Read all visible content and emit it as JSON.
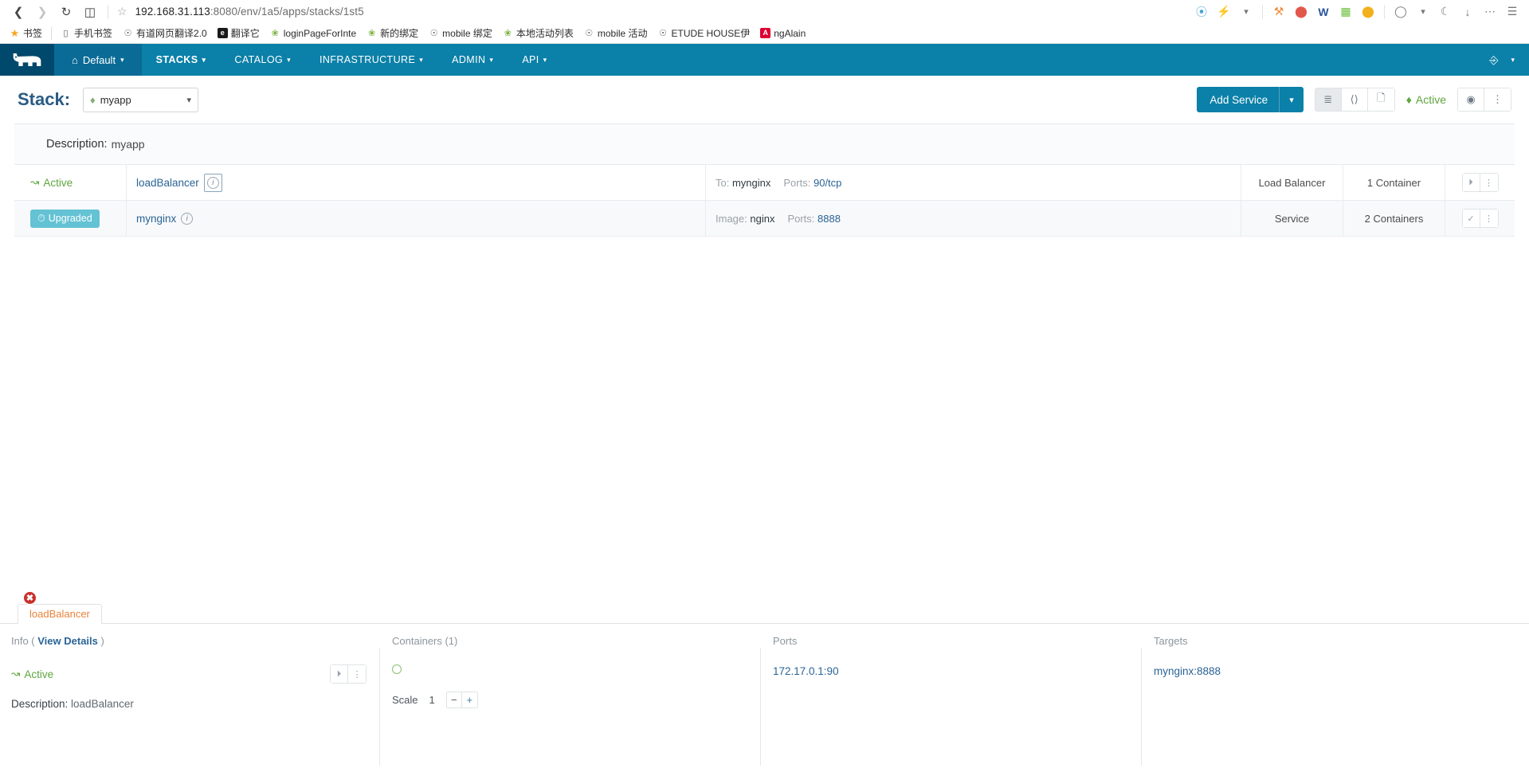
{
  "browser": {
    "back_icon": "back-arrow-icon",
    "forward_icon": "forward-arrow-icon",
    "reload_icon": "reload-icon",
    "reader_icon": "reader-view-icon",
    "star_icon": "star-icon",
    "url_prefix": "192.168.31.113",
    "url_suffix": ":8080/env/1a5/apps/stacks/1st5",
    "url_full": "192.168.31.113:8080/env/1a5/apps/stacks/1st5",
    "toolbar_icons": [
      {
        "name": "sync-icon",
        "glyph": "◔"
      },
      {
        "name": "flash-icon",
        "glyph": "⚡"
      },
      {
        "name": "chevron-down-icon",
        "glyph": "⌄"
      },
      {
        "name": "game-controller-icon",
        "glyph": "⚈"
      },
      {
        "name": "shield-icon",
        "glyph": "●"
      },
      {
        "name": "word-icon",
        "glyph": "W"
      },
      {
        "name": "grid-icon",
        "glyph": "⌗"
      },
      {
        "name": "circle-icon",
        "glyph": "◯"
      },
      {
        "name": "user-icon",
        "glyph": "○"
      },
      {
        "name": "moon-icon",
        "glyph": "☾"
      },
      {
        "name": "download-icon",
        "glyph": "⬇"
      },
      {
        "name": "more-icon",
        "glyph": "⋯"
      },
      {
        "name": "window-icon",
        "glyph": "⬜"
      }
    ],
    "bookmarks": [
      {
        "label": "书签",
        "icon": "star-icon",
        "type": "star"
      },
      {
        "label": "手机书签",
        "icon": "phone-icon",
        "type": "phone"
      },
      {
        "label": "有道网页翻译2.0",
        "icon": "globe-icon",
        "type": "globe"
      },
      {
        "label": "翻译它",
        "icon": "translate-icon",
        "type": "sqe"
      },
      {
        "label": "loginPageForInte",
        "icon": "leaf-icon",
        "type": "leaf"
      },
      {
        "label": "新的绑定",
        "icon": "leaf-icon",
        "type": "leaf"
      },
      {
        "label": "mobile 绑定",
        "icon": "globe-icon",
        "type": "globe"
      },
      {
        "label": "本地活动列表",
        "icon": "leaf-icon",
        "type": "leaf"
      },
      {
        "label": "mobile 活动",
        "icon": "globe-icon",
        "type": "globe"
      },
      {
        "label": "ETUDE HOUSE伊",
        "icon": "globe-icon",
        "type": "globe"
      },
      {
        "label": "ngAlain",
        "icon": "angular-icon",
        "type": "nga"
      }
    ]
  },
  "nav": {
    "logo": "rancher-cow-logo",
    "environment": "Default",
    "items": [
      {
        "label": "STACKS",
        "active": true
      },
      {
        "label": "CATALOG",
        "active": false
      },
      {
        "label": "INFRASTRUCTURE",
        "active": false
      },
      {
        "label": "ADMIN",
        "active": false
      },
      {
        "label": "API",
        "active": false
      }
    ],
    "user_icon": "user-icon",
    "user_caret": "⌄"
  },
  "stack_header": {
    "title": "Stack:",
    "selected_stack": "myapp",
    "add_service_label": "Add Service",
    "view_icons": [
      {
        "name": "list-view-icon",
        "glyph": "☰",
        "selected": true
      },
      {
        "name": "graph-view-icon",
        "glyph": "⚭",
        "selected": false
      },
      {
        "name": "config-view-icon",
        "glyph": "὜b",
        "selected": false
      }
    ],
    "state_label": "Active",
    "state_icon": "stack-icon",
    "action_icons": [
      {
        "name": "pause-icon",
        "glyph": "●"
      },
      {
        "name": "kebab-menu-icon",
        "glyph": "⋮"
      }
    ]
  },
  "description": {
    "key": "Description:",
    "value": "myapp"
  },
  "services": {
    "rows": [
      {
        "state": "Active",
        "state_type": "active",
        "name": "loadBalancer",
        "info_focused": true,
        "meta": [
          {
            "key": "To:",
            "value": "mynginx",
            "link": false
          },
          {
            "key": "Ports:",
            "value": "90/tcp",
            "link": true
          }
        ],
        "type": "Load Balancer",
        "containers": "1 Container",
        "actions": [
          {
            "name": "upgrade-icon",
            "glyph": "↑"
          },
          {
            "name": "kebab-menu-icon",
            "glyph": "⋮"
          }
        ]
      },
      {
        "state": "Upgraded",
        "state_type": "upgraded",
        "name": "mynginx",
        "info_focused": false,
        "meta": [
          {
            "key": "Image:",
            "value": "nginx",
            "link": false
          },
          {
            "key": "Ports:",
            "value": "8888",
            "link": true
          }
        ],
        "type": "Service",
        "containers": "2 Containers",
        "actions": [
          {
            "name": "confirm-upgrade-icon",
            "glyph": "✓"
          },
          {
            "name": "kebab-menu-icon",
            "glyph": "⋮"
          }
        ]
      }
    ]
  },
  "dock": {
    "tab_label": "loadBalancer",
    "tab_close_icon": "close-icon",
    "info": {
      "head_prefix": "Info (",
      "head_link": "View Details",
      "head_suffix": ")",
      "state": "Active",
      "actions": [
        {
          "name": "upgrade-icon",
          "glyph": "↑"
        },
        {
          "name": "kebab-menu-icon",
          "glyph": "⋮"
        }
      ],
      "desc_key": "Description:",
      "desc_value": "loadBalancer"
    },
    "containers": {
      "head": "Containers (1)",
      "instance_icon": "container-state-circle-icon",
      "scale_label": "Scale",
      "scale_value": "1",
      "minus": "−",
      "plus": "+"
    },
    "ports": {
      "head": "Ports",
      "value": "172.17.0.1:90"
    },
    "targets": {
      "head": "Targets",
      "value": "mynginx:8888"
    }
  }
}
